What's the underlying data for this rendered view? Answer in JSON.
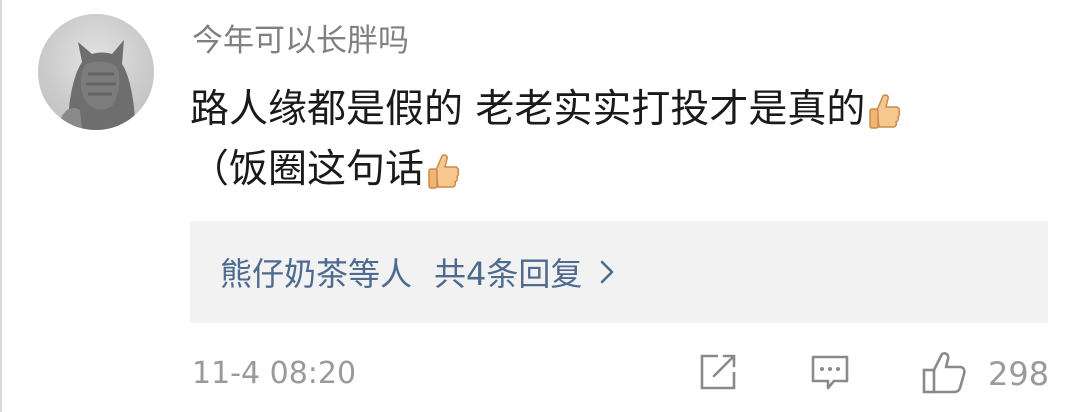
{
  "comment": {
    "username": "今年可以长胖吗",
    "content_line1": "路人缘都是假的 老老实实打投才是真的",
    "content_line2": "（饭圈这句话",
    "emoji": "thumbs-up"
  },
  "replies": {
    "names": "熊仔奶茶",
    "names_suffix": "等人",
    "count_label": "共4条回复"
  },
  "footer": {
    "timestamp": "11-4 08:20",
    "like_count": "298"
  },
  "icons": {
    "share": "share-icon",
    "comment": "comment-icon",
    "like": "like-icon",
    "chevron": "chevron-right-icon"
  },
  "colors": {
    "link": "#4e6a8e",
    "muted": "#9a9a9a",
    "reply_bg": "#f2f2f2"
  }
}
